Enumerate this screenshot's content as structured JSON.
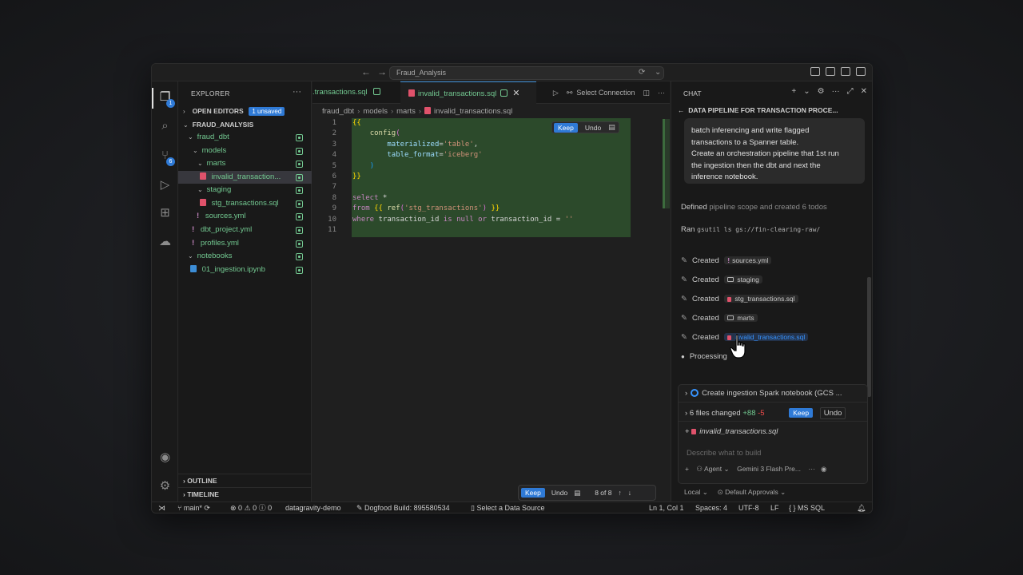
{
  "titlebar": {
    "search_text": "Fraud_Analysis"
  },
  "sidebar": {
    "title": "EXPLORER",
    "open_editors_label": "OPEN EDITORS",
    "unsaved_badge": "1 unsaved",
    "project": "FRAUD_ANALYSIS",
    "items": [
      {
        "label": "fraud_dbt"
      },
      {
        "label": "models"
      },
      {
        "label": "marts"
      },
      {
        "label": "invalid_transaction..."
      },
      {
        "label": "staging"
      },
      {
        "label": "stg_transactions.sql"
      },
      {
        "label": "sources.yml"
      },
      {
        "label": "dbt_project.yml"
      },
      {
        "label": "profiles.yml"
      },
      {
        "label": "notebooks"
      },
      {
        "label": "01_ingestion.ipynb"
      }
    ],
    "outline_label": "OUTLINE",
    "timeline_label": "TIMELINE"
  },
  "activity_badges": {
    "explorer": "1",
    "source_control": "6"
  },
  "editor": {
    "tab_inactive": ".transactions.sql",
    "tab_active": "invalid_transactions.sql",
    "select_connection": "Select Connection",
    "breadcrumb": [
      "fraud_dbt",
      "models",
      "marts",
      "invalid_transactions.sql"
    ],
    "line_numbers": [
      "1",
      "2",
      "3",
      "4",
      "5",
      "6",
      "7",
      "8",
      "9",
      "10",
      "11"
    ],
    "keep_label": "Keep",
    "undo_label": "Undo",
    "change_counter": "8 of 8"
  },
  "chat": {
    "header": "CHAT",
    "session_title": "DATA PIPELINE FOR TRANSACTION PROCE...",
    "bubble_lines": [
      "batch inferencing and write flagged",
      "transactions to a Spanner table.",
      "Create an orchestration pipeline that 1st run",
      "the ingestion then the dbt and next the",
      "inference notebook."
    ],
    "defined_prefix": "Defined",
    "defined_rest": "pipeline scope and created 6 todos",
    "ran_label": "Ran",
    "ran_cmd": "gsutil ls gs://fin-clearing-raw/",
    "created_label": "Created",
    "created_items": [
      "sources.yml",
      "staging",
      "stg_transactions.sql",
      "marts",
      "invalid_transactions.sql"
    ],
    "processing": "Processing",
    "todo_title": "Create ingestion Spark notebook (GCS ...",
    "files_changed": "6 files changed",
    "additions": "+88",
    "deletions": "-5",
    "keep_label": "Keep",
    "undo_label": "Undo",
    "changed_file": "invalid_transactions.sql",
    "input_placeholder": "Describe what to build",
    "agent_label": "Agent",
    "model_label": "Gemini 3 Flash Pre...",
    "local_label": "Local",
    "approvals_label": "Default Approvals"
  },
  "statusbar": {
    "branch": "main*",
    "errors": "0",
    "warnings": "0",
    "info": "0",
    "project": "datagravity-demo",
    "build": "Dogfood Build: 895580534",
    "datasource": "Select a Data Source",
    "position": "Ln 1, Col 1",
    "spaces": "Spaces: 4",
    "encoding": "UTF-8",
    "eol": "LF",
    "language": "MS SQL"
  },
  "colors": {
    "accent": "#2f7ad6",
    "git_added": "#73c991",
    "diff_bg": "#2c4a2b"
  }
}
